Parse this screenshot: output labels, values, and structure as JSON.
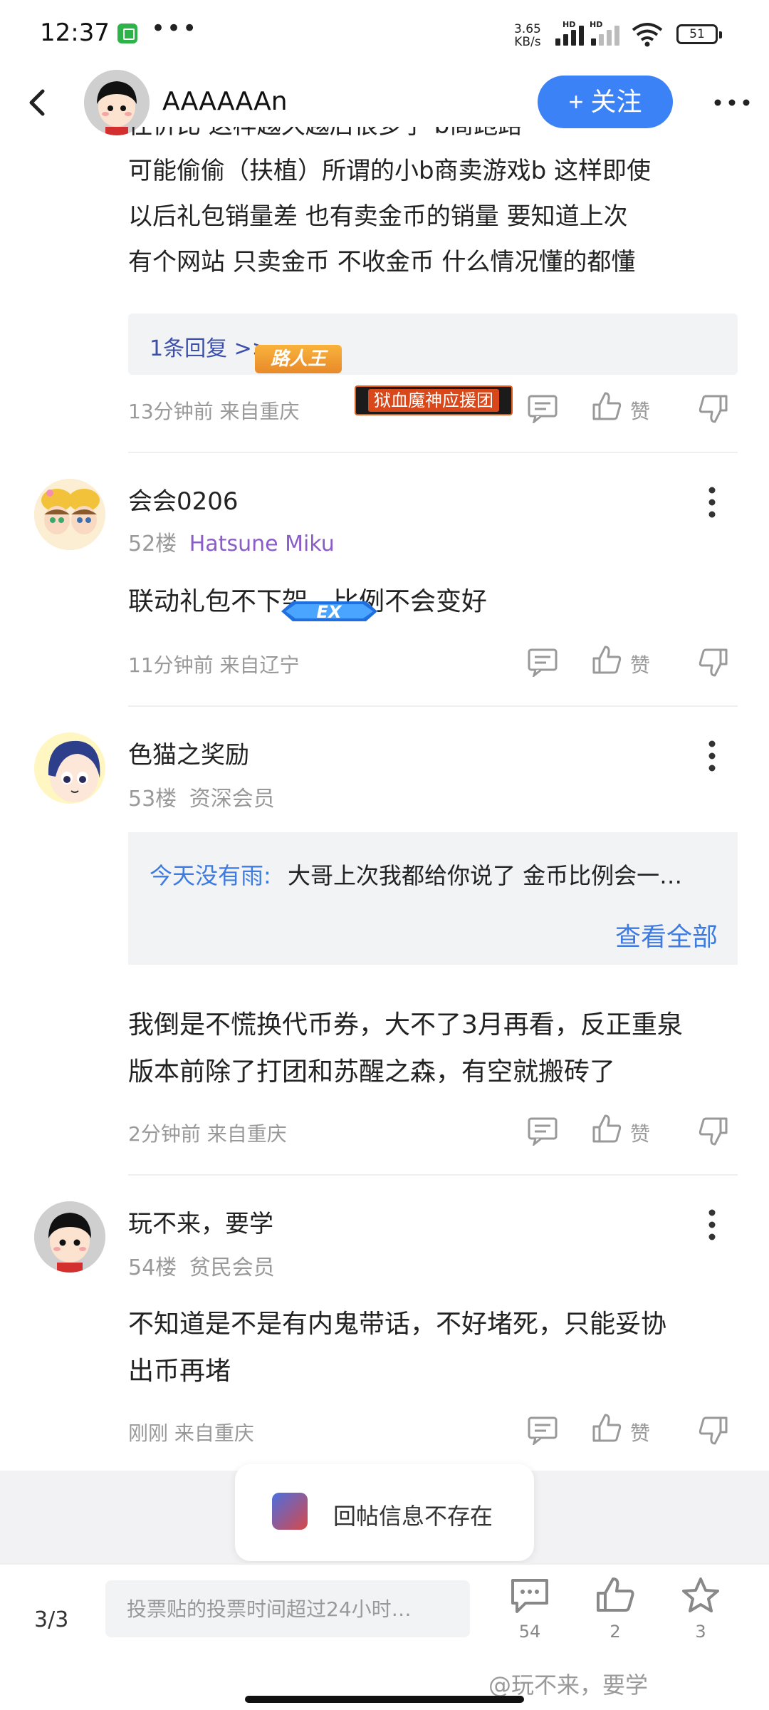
{
  "status_bar": {
    "time": "12:37",
    "dots": "•••",
    "net_speed_value": "3.65",
    "net_speed_unit": "KB/s",
    "hd1": "HD",
    "hd2": "HD",
    "battery": "51"
  },
  "header": {
    "author_name": "AAAAAAn",
    "follow_label": "+ 关注"
  },
  "prev_comment": {
    "text_lines": [
      "往价比  这样越久越后很多了 b商跑路",
      "可能偷偷（扶植）所谓的小b商卖游戏b 这样即使",
      "以后礼包销量差 也有卖金币的销量 要知道上次",
      "有个网站 只卖金币 不收金币 什么情况懂的都懂"
    ],
    "reply_link": "1条回复 >>",
    "meta": "13分钟前 来自重庆",
    "like_label": "赞"
  },
  "comments": [
    {
      "username": "会会0206",
      "badge": "路人王",
      "floor": "52楼",
      "title": "Hatsune Miku",
      "guild_badge": "狱血魔神应援团",
      "text": "联动礼包不下架，比例不会变好",
      "meta": "11分钟前 来自辽宁",
      "like_label": "赞"
    },
    {
      "username": "色猫之奖励",
      "badge": "EX",
      "floor": "53楼",
      "title": "资深会员",
      "quote_author": "今天没有雨:",
      "quote_text": "大哥上次我都给你说了 金币比例会一…",
      "quote_more": "查看全部",
      "text_lines": [
        "我倒是不慌换代币券，大不了3月再看，反正重泉",
        "版本前除了打团和苏醒之森，有空就搬砖了"
      ],
      "meta": "2分钟前 来自重庆",
      "like_label": "赞"
    },
    {
      "username": "玩不来，要学",
      "floor": "54楼",
      "title": "贫民会员",
      "text_lines": [
        "不知道是不是有内鬼带话，不好堵死，只能妥协",
        "出币再堵"
      ],
      "meta": "刚刚 来自重庆",
      "like_label": "赞"
    }
  ],
  "toast": {
    "message": "回帖信息不存在"
  },
  "bottom_bar": {
    "page": "3/3",
    "input_placeholder": "投票贴的投票时间超过24小时…",
    "comment_count": "54",
    "like_count": "2",
    "star_count": "3",
    "watermark": "@玩不来，要学"
  },
  "colors": {
    "accent": "#3b82f6",
    "link": "#3d7be0",
    "reply_link": "#3b4fa8",
    "meta": "#999999",
    "miku": "#8a5cc7"
  }
}
